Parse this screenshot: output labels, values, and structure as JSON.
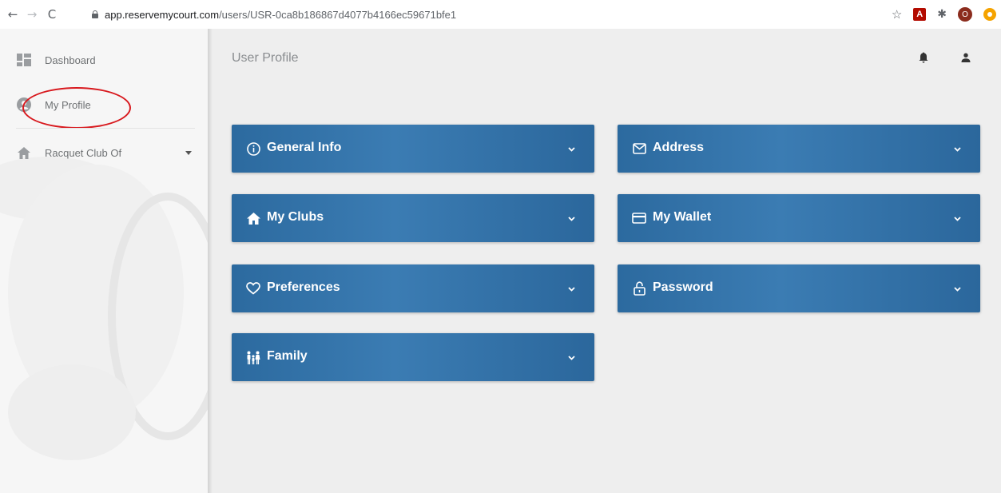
{
  "browser": {
    "url_host": "app.reservemycourt.com",
    "url_path": "/users/USR-0ca8b186867d4077b4166ec59671bfe1",
    "profile_initial": "O",
    "pdf_label": "A"
  },
  "sidebar": {
    "items": [
      {
        "label": "Dashboard",
        "icon": "dashboard-icon"
      },
      {
        "label": "My Profile",
        "icon": "account-circle-icon",
        "annotated": true
      },
      {
        "label": "Racquet Club Of",
        "icon": "home-icon",
        "has_dropdown": true
      }
    ]
  },
  "header": {
    "title": "User Profile",
    "icons": [
      "bell-icon",
      "user-icon"
    ]
  },
  "panels": [
    {
      "label": "General Info",
      "icon": "info-circle-icon"
    },
    {
      "label": "Address",
      "icon": "envelope-icon"
    },
    {
      "label": "My Clubs",
      "icon": "house-icon"
    },
    {
      "label": "My Wallet",
      "icon": "credit-card-icon"
    },
    {
      "label": "Preferences",
      "icon": "heart-icon"
    },
    {
      "label": "Password",
      "icon": "lock-icon"
    },
    {
      "label": "Family",
      "icon": "family-icon"
    }
  ],
  "colors": {
    "panel": "#2f6ea4",
    "annotation": "#d8191e",
    "sidebar_text": "#6f7274"
  }
}
